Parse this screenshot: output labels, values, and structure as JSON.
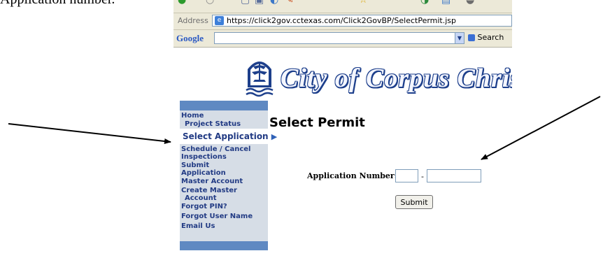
{
  "caption": "Application number.",
  "toolbar": {
    "glyphs": [
      "●",
      "○",
      "▢",
      "▣",
      "◐",
      "✎",
      "☆",
      "◑",
      "▤",
      "◒"
    ]
  },
  "address_bar": {
    "label": "Address",
    "url": "https://click2gov.cctexas.com/Click2GovBP/SelectPermit.jsp"
  },
  "google_toolbar": {
    "logo": "Google",
    "search_label": "Search",
    "search_value": ""
  },
  "site": {
    "title": "City of Corpus Christi"
  },
  "sidebar": {
    "items": [
      {
        "label": "Home"
      },
      {
        "label": "Project Status"
      },
      {
        "label": "Select Application",
        "arrow": "▶"
      },
      {
        "label": "Schedule / Cancel"
      },
      {
        "label": "Inspections"
      },
      {
        "label": "Submit"
      },
      {
        "label": "Application"
      },
      {
        "label": "Master Account"
      },
      {
        "label": "Create Master"
      },
      {
        "label": "Account"
      },
      {
        "label": "Forgot PIN?"
      },
      {
        "label": "Forgot User Name"
      },
      {
        "label": "Email Us"
      }
    ]
  },
  "main": {
    "title": "Select Permit",
    "field_label": "Application Number:",
    "field_part1": "",
    "field_part2": "",
    "separator": "-",
    "submit_label": "Submit"
  },
  "colors": {
    "nav_text": "#223b84",
    "sidebar_bg": "#d6dde6",
    "sidebar_cap": "#5f89c2",
    "logo_blue": "#1d3f8b"
  }
}
